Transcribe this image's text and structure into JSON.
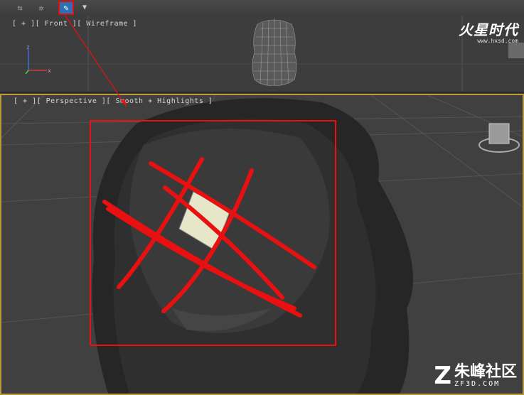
{
  "toolbar": {
    "buttons": [
      {
        "icon": "move-arrows-icon",
        "glyph": "⇆"
      },
      {
        "icon": "sparkle-icon",
        "glyph": "✲"
      },
      {
        "icon": "edit-mode-icon",
        "glyph": "✎"
      }
    ],
    "dropdown_glyph": "▼"
  },
  "front_viewport": {
    "label": "[ + ][ Front ][ Wireframe ]"
  },
  "perspective_viewport": {
    "label": "[ + ][ Perspective ][ Smooth + Highlights ]"
  },
  "watermark_top": {
    "brand": "火星时代",
    "url": "www.hxsd.com"
  },
  "watermark_bottom": {
    "brand": "朱峰社区",
    "url": "ZF3D.COM"
  },
  "colors": {
    "annotation_red": "#e81010",
    "viewport_border": "#b89b3e",
    "highlight_face": "#e6e6c8"
  }
}
